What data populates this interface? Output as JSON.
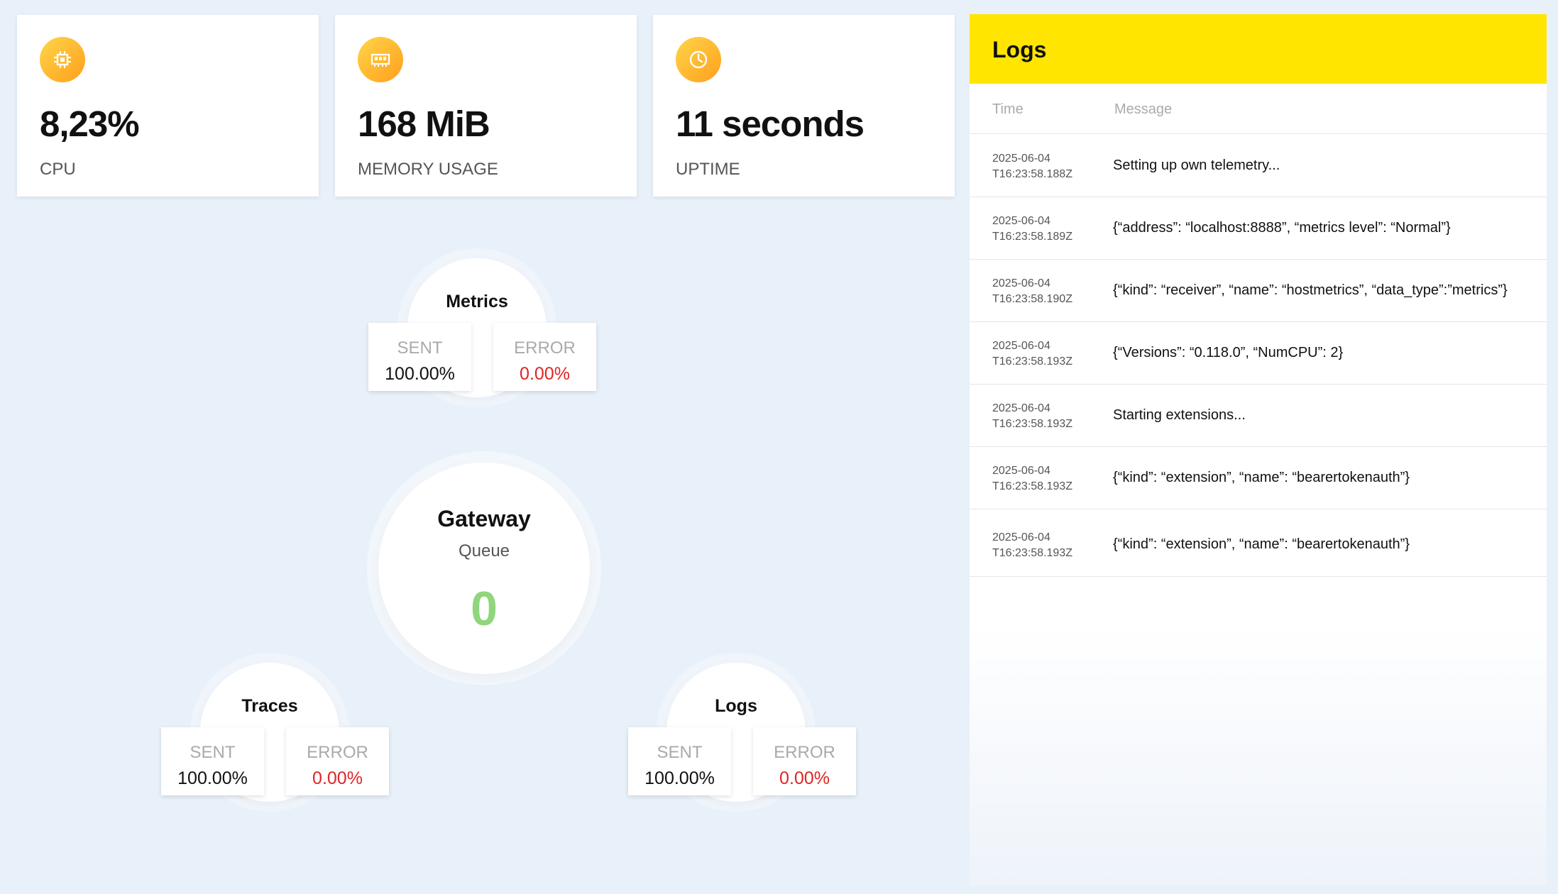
{
  "stats": [
    {
      "value": "8,23%",
      "label": "CPU",
      "icon": "cpu-icon"
    },
    {
      "value": "168 MiB",
      "label": "MEMORY USAGE",
      "icon": "memory-icon"
    },
    {
      "value": "11 seconds",
      "label": "UPTIME",
      "icon": "clock-icon"
    }
  ],
  "pipeline": {
    "metrics": {
      "title": "Metrics",
      "sent_label": "SENT",
      "sent_value": "100.00%",
      "error_label": "ERROR",
      "error_value": "0.00%"
    },
    "traces": {
      "title": "Traces",
      "sent_label": "SENT",
      "sent_value": "100.00%",
      "error_label": "ERROR",
      "error_value": "0.00%"
    },
    "logs": {
      "title": "Logs",
      "sent_label": "SENT",
      "sent_value": "100.00%",
      "error_label": "ERROR",
      "error_value": "0.00%"
    },
    "gateway": {
      "title": "Gateway",
      "subtitle": "Queue",
      "value": "0"
    }
  },
  "logs_panel": {
    "title": "Logs",
    "columns": {
      "time": "Time",
      "message": "Message"
    },
    "rows": [
      {
        "date": "2025-06-04",
        "time": "T16:23:58.188Z",
        "message": "Setting up own telemetry..."
      },
      {
        "date": "2025-06-04",
        "time": "T16:23:58.189Z",
        "message": "{“address”: “localhost:8888”, “metrics level”: “Normal”}"
      },
      {
        "date": "2025-06-04",
        "time": "T16:23:58.190Z",
        "message": "{“kind”: “receiver”, “name”: “hostmetrics”, “data_type”:”metrics”}"
      },
      {
        "date": "2025-06-04",
        "time": "T16:23:58.193Z",
        "message": "{“Versions”: “0.118.0”, “NumCPU”: 2}"
      },
      {
        "date": "2025-06-04",
        "time": "T16:23:58.193Z",
        "message": "Starting extensions..."
      },
      {
        "date": "2025-06-04",
        "time": "T16:23:58.193Z",
        "message": "{“kind”: “extension”, “name”: “bearertokenauth”}"
      },
      {
        "date": "2025-06-04",
        "time": "T16:23:58.193Z",
        "message": "{“kind”: “extension”, “name”: “bearertokenauth”}"
      }
    ]
  },
  "colors": {
    "accent_yellow": "#ffe500",
    "icon_gradient_start": "#ffd54a",
    "icon_gradient_end": "#ff9f1c",
    "error_red": "#e02424",
    "queue_green": "#8fd67c"
  }
}
